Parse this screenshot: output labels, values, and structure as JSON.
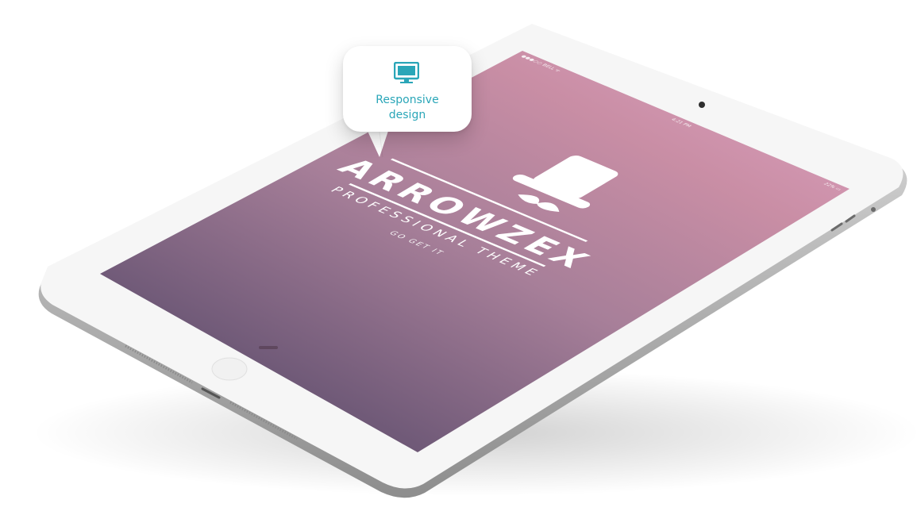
{
  "status_bar": {
    "carrier": "●●●○○ BELL ᯤ",
    "time": "4:21 PM",
    "battery": "22% ▭"
  },
  "logo": {
    "brand": "ARROWZEX",
    "tagline": "PROFESSIONAL THEME",
    "cta": "GO GET IT",
    "icon": "top-hat-mustache-icon"
  },
  "callout": {
    "icon": "desktop-monitor-icon",
    "label": "Responsive\ndesign"
  },
  "colors": {
    "accent": "#2aa6b8",
    "screen_top_right": "#d89cbc",
    "screen_bottom_left": "#5b3f58"
  }
}
